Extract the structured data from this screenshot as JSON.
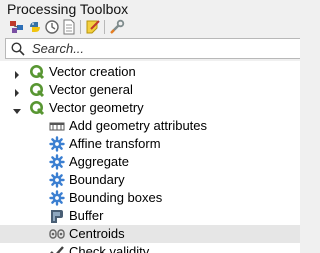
{
  "window": {
    "title": "Processing Toolbox"
  },
  "toolbar": {
    "buttons": [
      {
        "icon": "run-model-icon"
      },
      {
        "icon": "python-scripts-icon"
      },
      {
        "icon": "history-icon"
      },
      {
        "icon": "results-viewer-icon"
      },
      {
        "icon": "edit-features-in-place-icon"
      },
      {
        "icon": "options-icon"
      }
    ]
  },
  "search": {
    "placeholder": "Search...",
    "value": ""
  },
  "tree": {
    "groups": [
      {
        "label": "Vector creation",
        "expanded": false
      },
      {
        "label": "Vector general",
        "expanded": false
      },
      {
        "label": "Vector geometry",
        "expanded": true
      }
    ],
    "algorithms": [
      {
        "label": "Add geometry attributes",
        "icon": "field-calculator-icon"
      },
      {
        "label": "Affine transform",
        "icon": "gear-icon"
      },
      {
        "label": "Aggregate",
        "icon": "gear-icon"
      },
      {
        "label": "Boundary",
        "icon": "gear-icon"
      },
      {
        "label": "Bounding boxes",
        "icon": "gear-icon"
      },
      {
        "label": "Buffer",
        "icon": "buffer-icon"
      },
      {
        "label": "Centroids",
        "icon": "centroids-icon",
        "highlighted": true
      },
      {
        "label": "Check validity",
        "icon": "check-validity-icon"
      }
    ]
  },
  "colors": {
    "qgis_green": "#589632",
    "gear_blue": "#3b7fd1",
    "highlight_row": "#e6e6e6"
  }
}
